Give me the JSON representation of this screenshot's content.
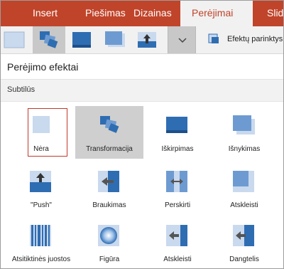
{
  "tabs": [
    {
      "label": "Insert",
      "active": false
    },
    {
      "label": "Piešimas",
      "active": false
    },
    {
      "label": "Dizainas",
      "active": false
    },
    {
      "label": "Perėjimai",
      "active": true
    },
    {
      "label": "Slid",
      "active": false
    }
  ],
  "ribbon": {
    "thumbs": [
      "Nėra",
      "Transformacija",
      "Iškirpimas",
      "Išnykimas",
      "\"Push\""
    ],
    "selected_thumb": "Transformacija",
    "more_icon": "chevron-down-icon",
    "effect_options_label": "Efektų parinktys"
  },
  "panel": {
    "title": "Perėjimo efektai",
    "section": "Subtilūs",
    "items": [
      {
        "label": "Nėra",
        "icon": "none-transition-icon",
        "selected": true,
        "highlighted": false
      },
      {
        "label": "Transformacija",
        "icon": "morph-transition-icon",
        "selected": false,
        "highlighted": true
      },
      {
        "label": "Iškirpimas",
        "icon": "cut-transition-icon",
        "selected": false,
        "highlighted": false
      },
      {
        "label": "Išnykimas",
        "icon": "fade-transition-icon",
        "selected": false,
        "highlighted": false
      },
      {
        "label": "\"Push\"",
        "icon": "push-transition-icon",
        "selected": false,
        "highlighted": false
      },
      {
        "label": "Braukimas",
        "icon": "wipe-transition-icon",
        "selected": false,
        "highlighted": false
      },
      {
        "label": "Perskirti",
        "icon": "split-transition-icon",
        "selected": false,
        "highlighted": false
      },
      {
        "label": "Atskleisti",
        "icon": "reveal-transition-icon",
        "selected": false,
        "highlighted": false
      },
      {
        "label": "Atsitiktinės juostos",
        "icon": "random-bars-transition-icon",
        "selected": false,
        "highlighted": false
      },
      {
        "label": "Figūra",
        "icon": "shape-transition-icon",
        "selected": false,
        "highlighted": false
      },
      {
        "label": "Atskleisti",
        "icon": "uncover-transition-icon",
        "selected": false,
        "highlighted": false
      },
      {
        "label": "Dangtelis",
        "icon": "cover-transition-icon",
        "selected": false,
        "highlighted": false
      }
    ]
  },
  "colors": {
    "accent": "#c0442a",
    "tile_light": "#c9d9ee",
    "tile_dark": "#2f6db2",
    "selection_border": "#c0392b",
    "hover_fill": "#cfcfcf"
  }
}
